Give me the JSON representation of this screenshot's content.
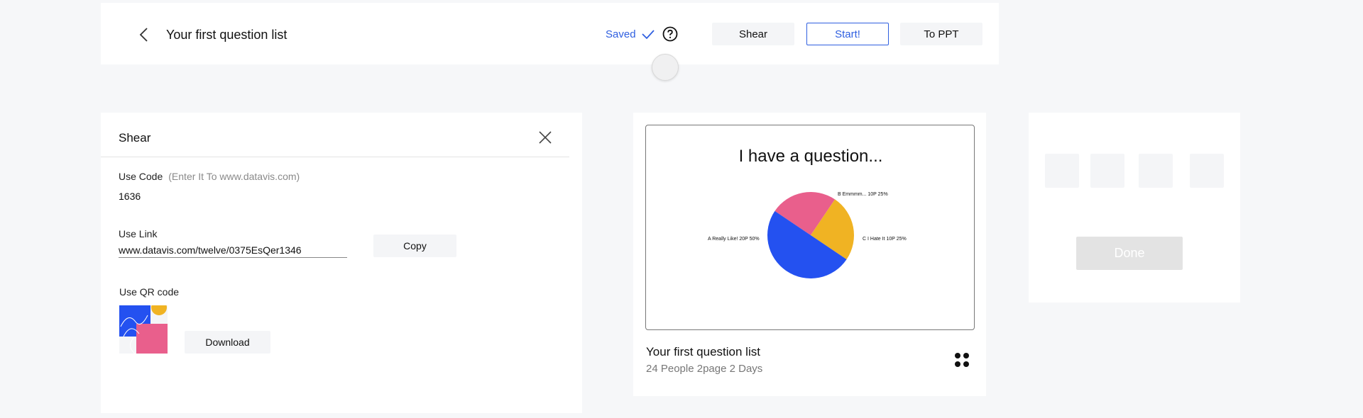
{
  "header": {
    "title": "Your first question list",
    "saved_label": "Saved",
    "buttons": {
      "shear": "Shear",
      "start": "Start!",
      "to_ppt": "To PPT"
    }
  },
  "share_panel": {
    "title": "Shear",
    "code_label": "Use Code",
    "code_hint": "(Enter It To www.datavis.com)",
    "code_value": "1636",
    "link_label": "Use Link",
    "link_value": "www.datavis.com/twelve/0375EsQer1346",
    "copy_label": "Copy",
    "qr_label": "Use QR code",
    "download_label": "Download"
  },
  "preview": {
    "card_title": "Your first question list",
    "card_meta": "24 People  2page 2 Days"
  },
  "chart_data": {
    "type": "pie",
    "title": "I have a question...",
    "categories": [
      "A Really Like! 20P 50%",
      "B Emmmm... 10P 25%",
      "C I Hate It 10P 25%"
    ],
    "values": [
      50,
      25,
      25
    ],
    "colors": [
      "#2451f0",
      "#e95f8c",
      "#f0b323"
    ]
  },
  "right_panel": {
    "done_label": "Done"
  }
}
